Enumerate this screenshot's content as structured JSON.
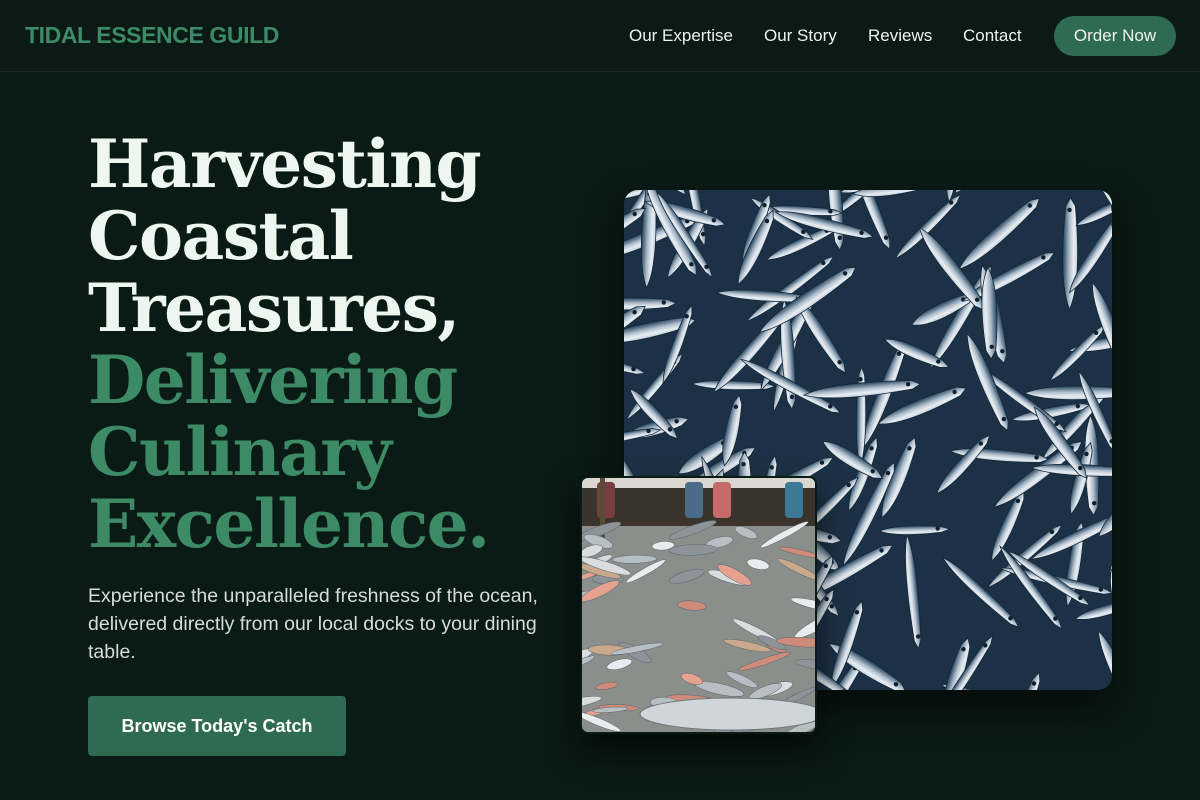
{
  "brand": {
    "name": "TIDAL ESSENCE GUILD"
  },
  "nav": {
    "items": [
      "Our Expertise",
      "Our Story",
      "Reviews",
      "Contact"
    ],
    "order_label": "Order Now"
  },
  "hero": {
    "headline_lines": [
      "Harvesting",
      "Coastal",
      "Treasures,"
    ],
    "headline_accent_lines": [
      "Delivering",
      "Culinary",
      "Excellence."
    ],
    "subtext": "Experience the unparalleled freshness of the ocean, delivered directly from our local docks to your dining table.",
    "cta_label": "Browse Today's Catch"
  },
  "colors": {
    "background": "#0a1a15",
    "accent": "#3c8a66",
    "button": "#2f6b52",
    "headline": "#eef6f0"
  }
}
